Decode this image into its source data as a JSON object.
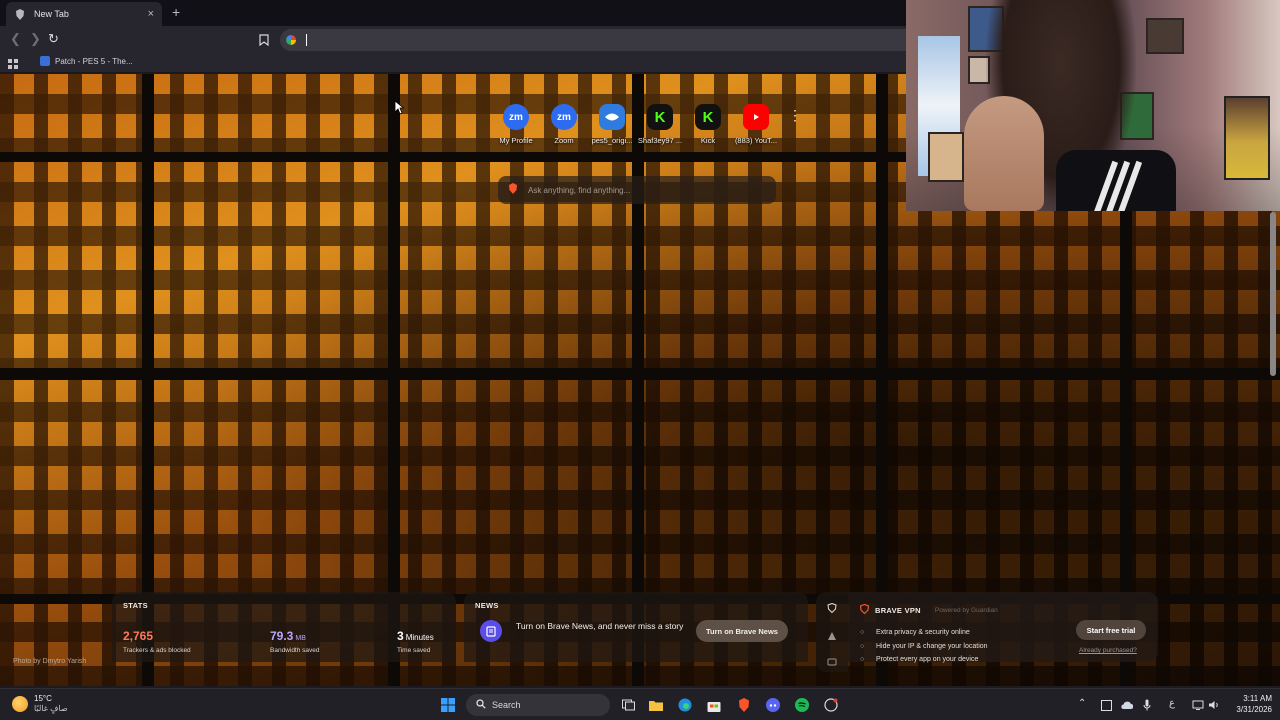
{
  "browser": {
    "tab": {
      "title": "New Tab",
      "close": "×"
    },
    "new_tab": "+",
    "address_bar": {
      "value": "",
      "placeholder": ""
    },
    "bookmarks_bar": {
      "items": [
        {
          "label": "Patch - PES 5 - The..."
        }
      ]
    }
  },
  "new_tab_page": {
    "top_sites": [
      {
        "name": "My Profile",
        "icon_text": "zm",
        "color": "#2d6cf0"
      },
      {
        "name": "Zoom",
        "icon_text": "zm",
        "color": "#2d6cf0"
      },
      {
        "name": "pes5_origi...",
        "icon_text": "",
        "color": "#2f7ce0"
      },
      {
        "name": "Shaf3ey97 ...",
        "icon_text": "K",
        "color": "#53fc18"
      },
      {
        "name": "Kick",
        "icon_text": "K",
        "color": "#53fc18"
      },
      {
        "name": "(883) YouT...",
        "icon_text": "",
        "color": "#ff0000"
      }
    ],
    "search": {
      "placeholder": "Ask anything, find anything..."
    },
    "photo_credit": "Photo by Dmytro Yarish",
    "stats": {
      "title": "STATS",
      "trackers": {
        "value": "2,765",
        "label": "Trackers & ads blocked",
        "color": "#ff7a56"
      },
      "bandwidth": {
        "value": "79.3",
        "unit": "MB",
        "label": "Bandwidth saved",
        "color": "#b9a6ff"
      },
      "time": {
        "value": "3",
        "unit": "Minutes",
        "label": "Time saved",
        "color": "#ffffff"
      }
    },
    "news": {
      "title": "NEWS",
      "text": "Turn on Brave News, and never miss a story",
      "button": "Turn on Brave News"
    },
    "vpn": {
      "title": "BRAVE VPN",
      "powered_by": "Powered by Guardian",
      "features": [
        "Extra privacy & security online",
        "Hide your IP & change your location",
        "Protect every app on your device"
      ],
      "cta": "Start free trial",
      "already": "Already purchased?"
    }
  },
  "taskbar": {
    "weather": {
      "temp": "15°C",
      "condition": "صافٍ غالبًا"
    },
    "search_label": "Search",
    "language": "ع",
    "time": "3:11 AM",
    "date": "3/31/2026"
  },
  "colors": {
    "brave_orange": "#fb542b",
    "accent_purple": "#5b4ee8"
  }
}
